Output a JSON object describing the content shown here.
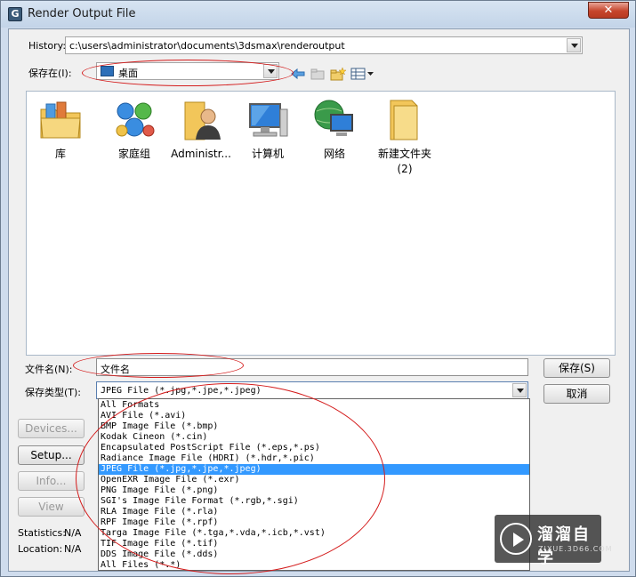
{
  "window": {
    "title": "Render Output File",
    "close_glyph": "✕"
  },
  "history": {
    "label": "History:",
    "value": "c:\\users\\administrator\\documents\\3dsmax\\renderoutput"
  },
  "save_in": {
    "label": "保存在(I):",
    "value": "桌面"
  },
  "files": [
    {
      "name": "库",
      "icon": "library-folder-icon"
    },
    {
      "name": "家庭组",
      "icon": "homegroup-icon"
    },
    {
      "name": "Administr...",
      "icon": "user-folder-icon"
    },
    {
      "name": "计算机",
      "icon": "computer-icon"
    },
    {
      "name": "网络",
      "icon": "network-icon"
    },
    {
      "name": "新建文件夹\n(2)",
      "icon": "folder-icon"
    }
  ],
  "filename": {
    "label": "文件名(N):",
    "value": "文件名"
  },
  "filetype": {
    "label": "保存类型(T):",
    "value": "JPEG File (*.jpg,*.jpe,*.jpeg)",
    "options": [
      "All Formats",
      "AVI File (*.avi)",
      "BMP Image File (*.bmp)",
      "Kodak Cineon (*.cin)",
      "Encapsulated PostScript File (*.eps,*.ps)",
      "Radiance Image File (HDRI) (*.hdr,*.pic)",
      "JPEG File (*.jpg,*.jpe,*.jpeg)",
      "OpenEXR Image File (*.exr)",
      "PNG Image File (*.png)",
      "SGI's Image File Format (*.rgb,*.sgi)",
      "RLA Image File (*.rla)",
      "RPF Image File (*.rpf)",
      "Targa Image File (*.tga,*.vda,*.icb,*.vst)",
      "TIF Image File (*.tif)",
      "DDS Image File (*.dds)",
      "All Files (*.*)"
    ],
    "selected_index": 6
  },
  "buttons": {
    "save": "保存(S)",
    "cancel": "取消",
    "devices": "Devices...",
    "setup": "Setup...",
    "info": "Info...",
    "view": "View"
  },
  "statistics": {
    "label": "Statistics:",
    "value": "N/A"
  },
  "location": {
    "label": "Location:",
    "value": "N/A"
  },
  "watermark": {
    "brand": "溜溜自学",
    "url": "ZIXUE.3D66.COM"
  },
  "colors": {
    "selection": "#3399ff",
    "annotation": "#d41c1c",
    "close": "#c6452c"
  }
}
